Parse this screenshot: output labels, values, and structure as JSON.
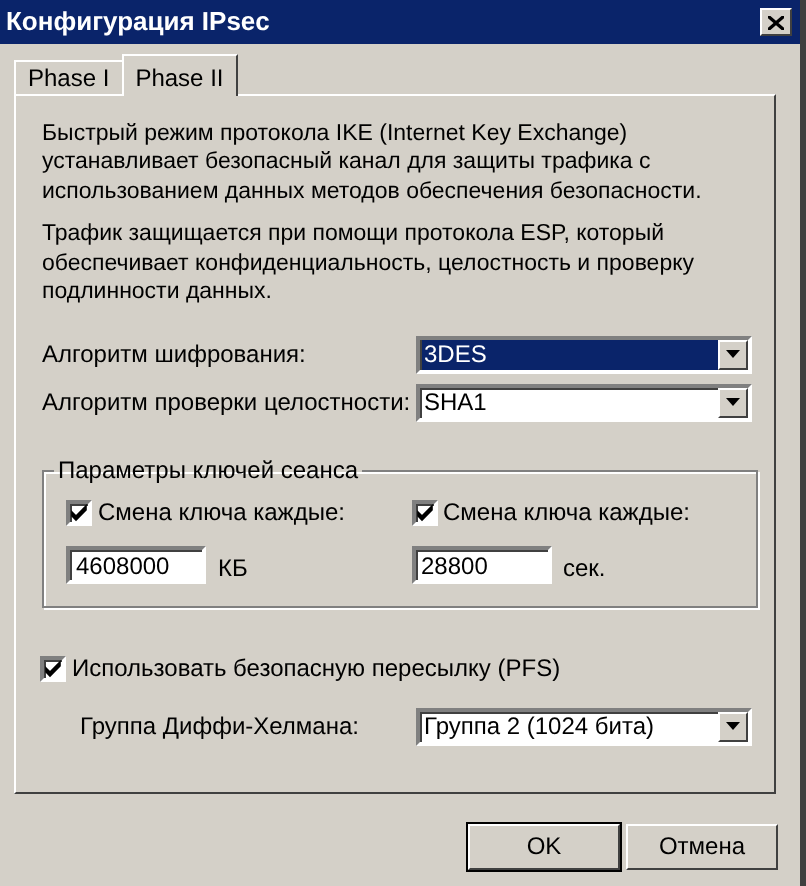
{
  "window": {
    "title": "Конфигурация IPsec"
  },
  "tabs": [
    {
      "label": "Phase I",
      "selected": false
    },
    {
      "label": "Phase II",
      "selected": true
    }
  ],
  "description": [
    "Быстрый режим протокола IKE (Internet Key Exchange) устанавливает безопасный канал для защиты трафика с использованием данных методов обеспечения безопасности.",
    "Трафик защищается при помощи протокола ESP, который обеспечивает конфиденциальность, целостность и проверку подлинности данных."
  ],
  "algorithms": [
    {
      "label": "Алгоритм шифрования:",
      "value": "3DES",
      "focused": true
    },
    {
      "label": "Алгоритм проверки целостности:",
      "value": "SHA1",
      "focused": false
    }
  ],
  "session_keys": {
    "title": "Параметры ключей сеанса",
    "items": [
      {
        "label": "Смена ключа каждые:",
        "checked": true,
        "value": "4608000",
        "unit": "КБ"
      },
      {
        "label": "Смена ключа каждые:",
        "checked": true,
        "value": "28800",
        "unit": "сек."
      }
    ]
  },
  "pfs": {
    "label": "Использовать безопасную пересылку (PFS)",
    "checked": true
  },
  "dh_group": {
    "label": "Группа Диффи-Хелмана:",
    "value": "Группа 2 (1024 бита)",
    "focused": false
  },
  "buttons": [
    {
      "label": "OK",
      "default": true
    },
    {
      "label": "Отмена",
      "default": false
    }
  ]
}
